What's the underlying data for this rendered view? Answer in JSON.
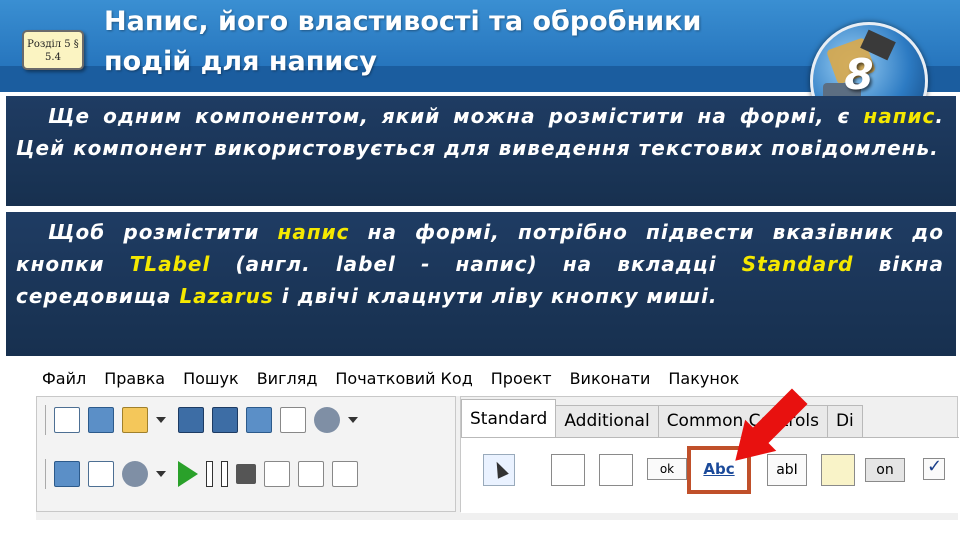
{
  "header": {
    "title": "Напис, його властивості та обробники подій для напису",
    "section_badge": "Розділ 5 § 5.4",
    "grade_number": "8"
  },
  "paragraph1": {
    "before": "Ще одним компонентом, який можна розмістити на формі, є ",
    "highlight": "напис",
    "after": ". Цей компонент використовується для виведення текстових повідомлень."
  },
  "paragraph2": {
    "p1": "Щоб розмістити ",
    "h1": "напис",
    "p2": " на формі, потрібно підвести вказівник до кнопки ",
    "h2": "TLabel",
    "p3": " (англ. label - напис) на вкладці ",
    "h3": "Standard",
    "p4": " вікна середовища ",
    "h4": "Lazarus",
    "p5": " і двічі клацнути ліву кнопку миші."
  },
  "ide": {
    "menu": [
      "Файл",
      "Правка",
      "Пошук",
      "Вигляд",
      "Початковий Код",
      "Проект",
      "Виконати",
      "Пакунок"
    ],
    "tabs": [
      "Standard",
      "Additional",
      "Common Controls",
      "Di"
    ],
    "components": {
      "ok_label": "ok",
      "abc_label": "Abc",
      "abi_label": "abI",
      "on_label": "on"
    }
  },
  "colors": {
    "highlight": "#f5e800",
    "block_bg": "#1f3c63",
    "header_bg": "#2a7ec8",
    "arrow": "#e8110f",
    "selection_box": "#c0502a"
  }
}
